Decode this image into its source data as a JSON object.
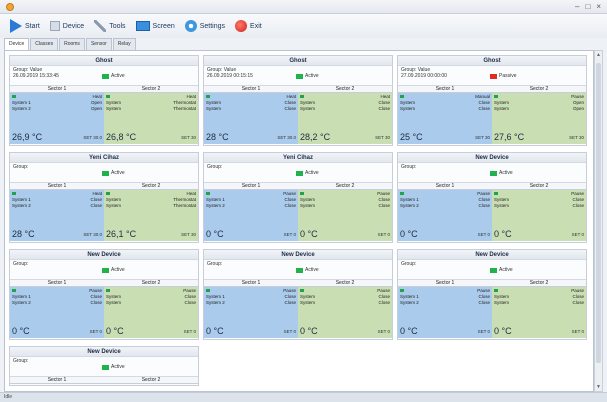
{
  "window": {
    "min": "–",
    "max": "□",
    "close": "×"
  },
  "toolbar": [
    {
      "label": "Start",
      "icon": "start-icon"
    },
    {
      "label": "Device",
      "icon": "device-icon"
    },
    {
      "label": "Tools",
      "icon": "tools-icon"
    },
    {
      "label": "Screen",
      "icon": "screen-icon"
    },
    {
      "label": "Settings",
      "icon": "settings-icon"
    },
    {
      "label": "Exit",
      "icon": "exit-icon"
    }
  ],
  "tabs": [
    "Device",
    "Classes",
    "Rooms",
    "Sensor",
    "Relay"
  ],
  "cards": [
    {
      "title": "Ghost",
      "group": "Group:",
      "group_val": "Value",
      "time": "26.09.2019 15:33:45",
      "status": "Active",
      "status_color": "green",
      "s1": "Sector 1",
      "s2": "Sector 2",
      "left": [
        [
          "",
          "Heat"
        ],
        [
          "System 1",
          "Open"
        ],
        [
          "System 2",
          "Open"
        ]
      ],
      "right": [
        [
          "",
          "Heat"
        ],
        [
          "System",
          "Thermostat"
        ],
        [
          "System",
          "Thermostat"
        ]
      ],
      "t1": "26,9 °C",
      "t2": "26,8 °C",
      "m1": "SET 30.0",
      "m2": "SET 30"
    },
    {
      "title": "Ghost",
      "group": "Group:",
      "group_val": "Value",
      "time": "26.09.2019 00:15:15",
      "status": "Active",
      "status_color": "green",
      "s1": "Sector 1",
      "s2": "Sector 2",
      "left": [
        [
          "",
          "Heat"
        ],
        [
          "System",
          "Close"
        ],
        [
          "System",
          "Close"
        ]
      ],
      "right": [
        [
          "",
          "Heat"
        ],
        [
          "System",
          "Close"
        ],
        [
          "System",
          "Close"
        ]
      ],
      "t1": "28 °C",
      "t2": "28,2 °C",
      "m1": "SET 30.0",
      "m2": "SET 30"
    },
    {
      "title": "Ghost",
      "group": "Group:",
      "group_val": "Value",
      "time": "27.09.2019 00:00:00",
      "status": "Passive",
      "status_color": "red",
      "s1": "Sector 1",
      "s2": "Sector 2",
      "left": [
        [
          "",
          "Manual"
        ],
        [
          "System",
          "Close"
        ],
        [
          "System",
          "Close"
        ]
      ],
      "right": [
        [
          "",
          "Pause"
        ],
        [
          "System",
          "Open"
        ],
        [
          "System",
          "Open"
        ]
      ],
      "t1": "25 °C",
      "t2": "27,6 °C",
      "m1": "SET 30",
      "m2": "SET 30"
    },
    {
      "title": "Yeni Cihaz",
      "group": "Group:",
      "group_val": "",
      "time": "",
      "status": "Active",
      "status_color": "green",
      "s1": "Sector 1",
      "s2": "Sector 2",
      "left": [
        [
          "",
          "Heat"
        ],
        [
          "System 1",
          "Close"
        ],
        [
          "System 2",
          "Close"
        ]
      ],
      "right": [
        [
          "",
          "Heat"
        ],
        [
          "System",
          "Thermostat"
        ],
        [
          "System",
          "Thermostat"
        ]
      ],
      "t1": "28 °C",
      "t2": "26,1 °C",
      "m1": "SET 30.0",
      "m2": "SET 30"
    },
    {
      "title": "Yeni Cihaz",
      "group": "Group:",
      "group_val": "",
      "time": "",
      "status": "Active",
      "status_color": "green",
      "s1": "Sector 1",
      "s2": "Sector 2",
      "left": [
        [
          "",
          "Pause"
        ],
        [
          "System 1",
          "Close"
        ],
        [
          "System 2",
          "Close"
        ]
      ],
      "right": [
        [
          "",
          "Pause"
        ],
        [
          "System",
          "Close"
        ],
        [
          "System",
          "Close"
        ]
      ],
      "t1": "0 °C",
      "t2": "0 °C",
      "m1": "SET 0",
      "m2": "SET 0"
    },
    {
      "title": "New Device",
      "group": "Group:",
      "group_val": "",
      "time": "",
      "status": "Active",
      "status_color": "green",
      "s1": "Sector 1",
      "s2": "Sector 2",
      "left": [
        [
          "",
          "Pause"
        ],
        [
          "System 1",
          "Close"
        ],
        [
          "System 2",
          "Close"
        ]
      ],
      "right": [
        [
          "",
          "Pause"
        ],
        [
          "System",
          "Close"
        ],
        [
          "System",
          "Close"
        ]
      ],
      "t1": "0 °C",
      "t2": "0 °C",
      "m1": "SET 0",
      "m2": "SET 0"
    },
    {
      "title": "New Device",
      "group": "Group:",
      "group_val": "",
      "time": "",
      "status": "Active",
      "status_color": "green",
      "s1": "Sector 1",
      "s2": "Sector 2",
      "left": [
        [
          "",
          "Pause"
        ],
        [
          "System 1",
          "Close"
        ],
        [
          "System 2",
          "Close"
        ]
      ],
      "right": [
        [
          "",
          "Pause"
        ],
        [
          "System",
          "Close"
        ],
        [
          "System",
          "Close"
        ]
      ],
      "t1": "0 °C",
      "t2": "0 °C",
      "m1": "SET 0",
      "m2": "SET 0"
    },
    {
      "title": "New Device",
      "group": "Group:",
      "group_val": "",
      "time": "",
      "status": "Active",
      "status_color": "green",
      "s1": "Sector 1",
      "s2": "Sector 2",
      "left": [
        [
          "",
          "Pause"
        ],
        [
          "System 1",
          "Close"
        ],
        [
          "System 2",
          "Close"
        ]
      ],
      "right": [
        [
          "",
          "Pause"
        ],
        [
          "System",
          "Close"
        ],
        [
          "System",
          "Close"
        ]
      ],
      "t1": "0 °C",
      "t2": "0 °C",
      "m1": "SET 0",
      "m2": "SET 0"
    },
    {
      "title": "New Device",
      "group": "Group:",
      "group_val": "",
      "time": "",
      "status": "Active",
      "status_color": "green",
      "s1": "Sector 1",
      "s2": "Sector 2",
      "left": [
        [
          "",
          "Pause"
        ],
        [
          "System 1",
          "Close"
        ],
        [
          "System 2",
          "Close"
        ]
      ],
      "right": [
        [
          "",
          "Pause"
        ],
        [
          "System",
          "Close"
        ],
        [
          "System",
          "Close"
        ]
      ],
      "t1": "0 °C",
      "t2": "0 °C",
      "m1": "SET 0",
      "m2": "SET 0"
    },
    {
      "title": "New Device",
      "group": "Group:",
      "group_val": "",
      "time": "",
      "status": "Active",
      "status_color": "green",
      "s1": "Sector 1",
      "s2": "Sector 2",
      "short": true
    }
  ],
  "statusbar": "Idle"
}
